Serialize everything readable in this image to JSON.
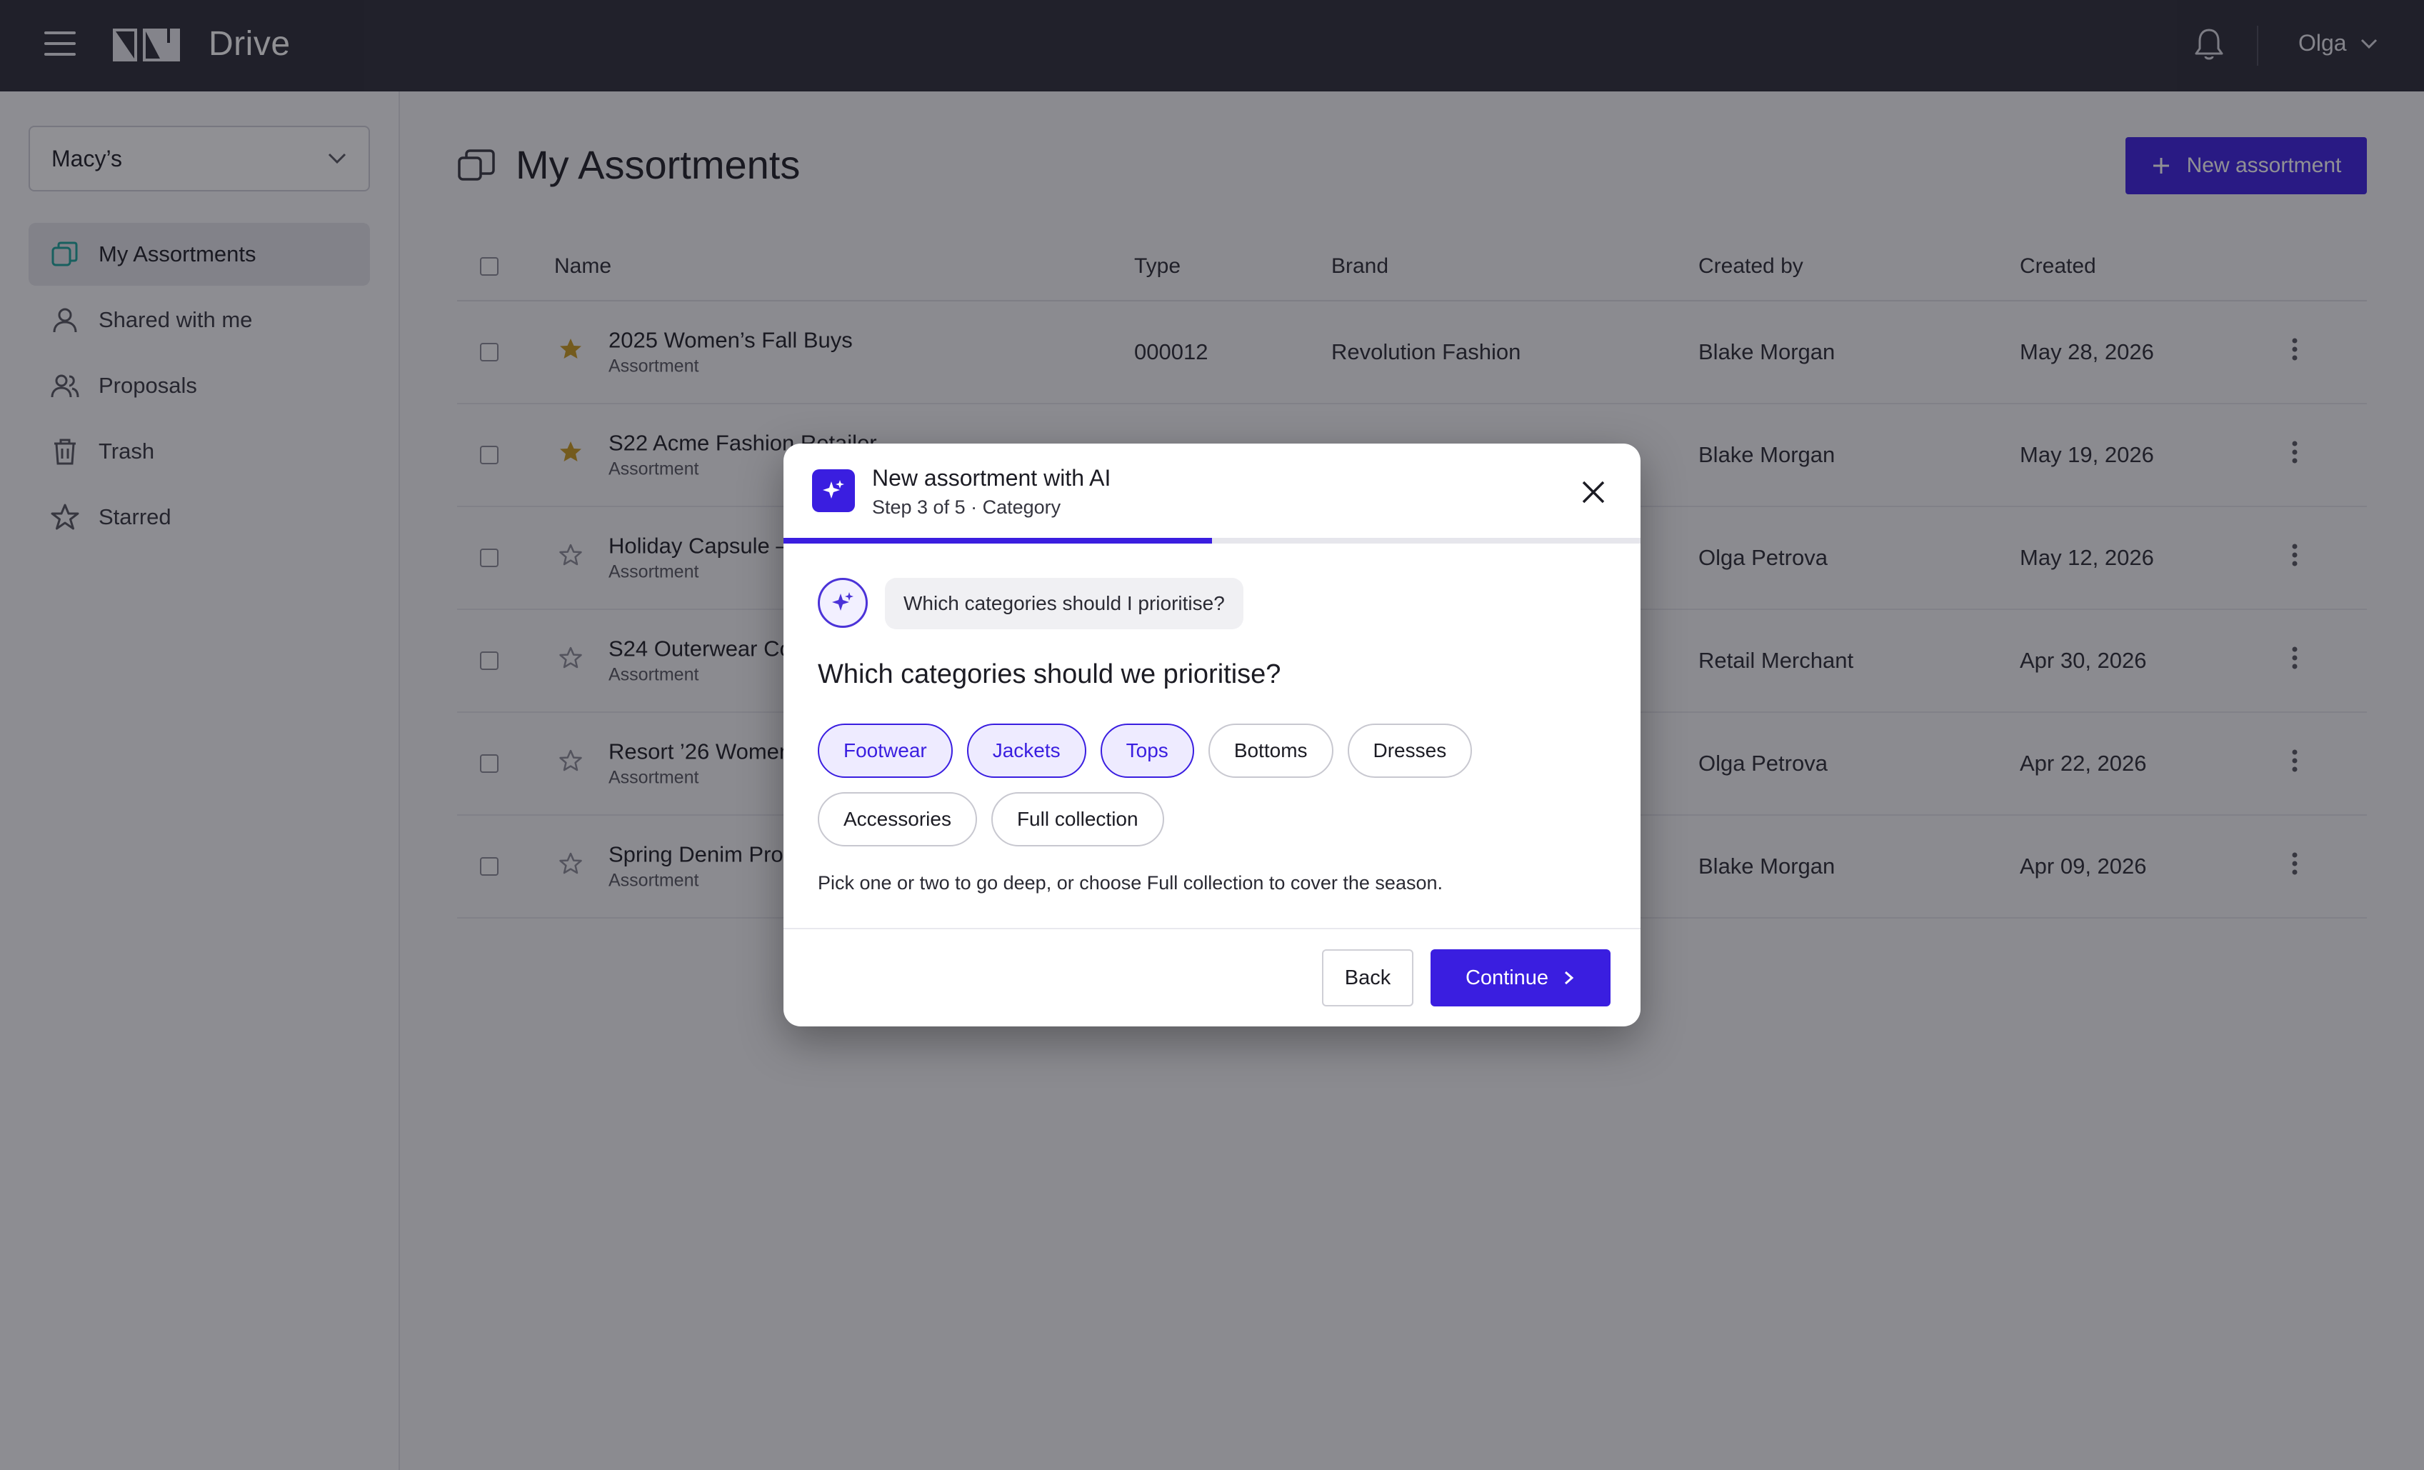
{
  "topbar": {
    "app_title": "Drive",
    "user_name": "Olga"
  },
  "sidebar": {
    "org": "Macy’s",
    "items": [
      {
        "label": "My Assortments",
        "icon": "assortments-icon",
        "active": true
      },
      {
        "label": "Shared with me",
        "icon": "person-icon"
      },
      {
        "label": "Proposals",
        "icon": "people-icon"
      },
      {
        "label": "Trash",
        "icon": "trash-icon"
      },
      {
        "label": "Starred",
        "icon": "star-outline-icon"
      }
    ]
  },
  "main": {
    "title": "My Assortments",
    "new_button": "New assortment",
    "columns": {
      "name": "Name",
      "type": "Type",
      "brand": "Brand",
      "created_by": "Created by",
      "created": "Created"
    },
    "rows": [
      {
        "name": "2025 Women’s Fall Buys",
        "sub": "Assortment",
        "type": "000012",
        "brand": "Revolution Fashion",
        "created_by": "Blake Morgan",
        "created": "May 28, 2026",
        "starred": true
      },
      {
        "name": "S22 Acme Fashion Retailer",
        "sub": "Assortment",
        "type": "",
        "brand": "",
        "created_by": "Blake Morgan",
        "created": "May 19, 2026",
        "starred": true
      },
      {
        "name": "Holiday Capsule —",
        "sub": "Assortment",
        "type": "",
        "brand": "",
        "created_by": "Olga Petrova",
        "created": "May 12, 2026",
        "starred": false
      },
      {
        "name": "S24 Outerwear Co",
        "sub": "Assortment",
        "type": "",
        "brand": "",
        "created_by": "Retail Merchant",
        "created": "Apr 30, 2026",
        "starred": false
      },
      {
        "name": "Resort ’26 Women",
        "sub": "Assortment",
        "type": "",
        "brand": "",
        "created_by": "Olga Petrova",
        "created": "Apr 22, 2026",
        "starred": false
      },
      {
        "name": "Spring Denim Prog",
        "sub": "Assortment",
        "type": "",
        "brand": "",
        "created_by": "Blake Morgan",
        "created": "Apr 09, 2026",
        "starred": false
      }
    ]
  },
  "modal": {
    "title": "New assortment with AI",
    "step": "Step 3 of 5 · Category",
    "progress": 0.5,
    "bot_message": "Which categories should I prioritise?",
    "question": "Which categories should we prioritise?",
    "chips": [
      {
        "label": "Footwear",
        "selected": true
      },
      {
        "label": "Jackets",
        "selected": true
      },
      {
        "label": "Tops",
        "selected": true
      },
      {
        "label": "Bottoms",
        "selected": false
      },
      {
        "label": "Dresses",
        "selected": false
      },
      {
        "label": "Accessories",
        "selected": false
      },
      {
        "label": "Full collection",
        "selected": false
      }
    ],
    "hint": "Pick one or two to go deep, or choose Full collection to cover the season.",
    "back_label": "Back",
    "continue_label": "Continue"
  },
  "colors": {
    "accent": "#3a1ee0",
    "topbar": "#2a2a35",
    "star": "#c99a1e",
    "teal_icon": "#1aa39a"
  }
}
